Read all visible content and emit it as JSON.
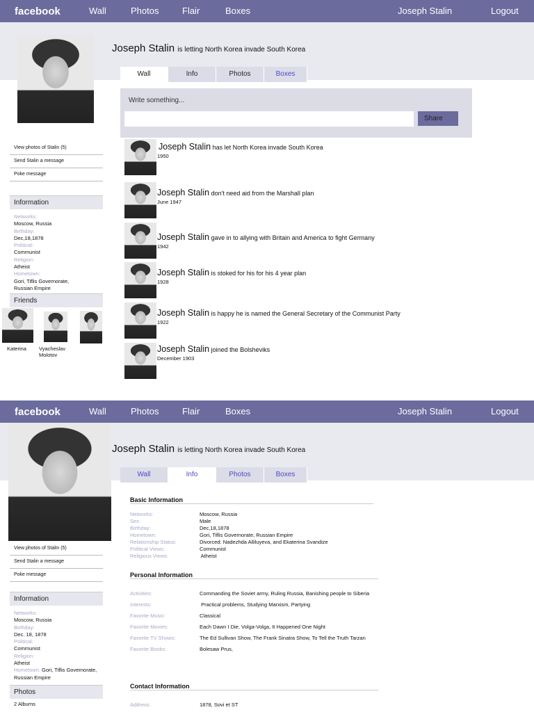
{
  "nav": {
    "logo": "facebook",
    "items": [
      "Wall",
      "Photos",
      "Flair",
      "Boxes"
    ],
    "user": "Joseph Stalin",
    "logout": "Logout"
  },
  "profile": {
    "name": "Joseph Stalin",
    "status": "is letting North Korea invade South Korea"
  },
  "tabs": [
    "Wall",
    "Info",
    "Photos",
    "Boxes"
  ],
  "sidebar1": {
    "links": [
      "View photos of Stalin  (5)",
      "Send Stalin a message",
      "Poke message"
    ],
    "information_title": "Information",
    "info": [
      [
        "Networks:",
        "Moscow, Russia"
      ],
      [
        "Birthday:",
        "Dec,18,1878"
      ],
      [
        "Political:",
        "Communist"
      ],
      [
        "Religion:",
        "Atheist"
      ],
      [
        "Hometown:",
        "Gori, Tiflis Governorate, Russian Empire"
      ]
    ],
    "friends_title": "Friends",
    "friends": [
      "Katerina",
      "Vyacheslav Molotov",
      ""
    ]
  },
  "wall": {
    "prompt": "Write something...",
    "input_value": "",
    "share": "Share",
    "posts": [
      {
        "name": "Joseph Stalin",
        "text": "has let North Korea invade South Korea",
        "date": "1950"
      },
      {
        "name": "Joseph Stalin",
        "text": "don't need aid from the Marshall plan",
        "date": "June 1947"
      },
      {
        "name": "Joseph Stalin",
        "text": "gave in to allying  with Britain and America to fight  Germany",
        "date": "1942"
      },
      {
        "name": "Joseph Stalin",
        "text": "is stoked for his for his 4 year plan",
        "date": "1928"
      },
      {
        "name": "Joseph Stalin",
        "text": " is happy he is named the General  Secretary of the Communist Party",
        "date": "1922"
      },
      {
        "name": "Joseph Stalin",
        "text": "joined the Bolsheviks",
        "date": "December 1903"
      }
    ]
  },
  "sidebar2": {
    "links": [
      "View photos of Stalin (5)",
      "Send Stalin a message",
      "Poke message"
    ],
    "information_title": "Information",
    "info": [
      [
        "Networks:",
        "Moscow, Russia"
      ],
      [
        "Birthday:",
        "Dec. 18, 1878"
      ],
      [
        "Political:",
        "Communist"
      ],
      [
        "Religion:",
        "Atheist"
      ],
      [
        "Hometown:",
        "Gori, Tiflis Governorate, Russian Empire"
      ]
    ],
    "photos_title": "Photos",
    "albums": "2 Albums"
  },
  "info_page": {
    "basic_title": "Basic Information",
    "basic": [
      [
        "Networks:",
        "Moscow, Russia"
      ],
      [
        "Sex:",
        "Male"
      ],
      [
        "Birthday:",
        "Dec,18,1878"
      ],
      [
        "Hometown:",
        "Gori, Tiflis Governorate, Russian Empire"
      ],
      [
        "Relationship Status:",
        "Divorced: Nadezhda  Alliluyeva, and Ekaterina  Svandize"
      ],
      [
        "Political Views:",
        "Communist"
      ],
      [
        "Religious Views:",
        " Atheist"
      ]
    ],
    "personal_title": "Personal Information",
    "personal": [
      [
        "Activities:",
        "Commanding the Soviet army, Ruling Russia, Banishing people to Siberia"
      ],
      [
        "Interests:",
        " Practical problems, Studying  Marxism, Partying"
      ],
      [
        "Favorite Music:",
        "Classical"
      ],
      [
        "Favorite Movies:",
        "Each Dawn I Die, Volga-Volga, It Happened  One  Night"
      ],
      [
        "Favorite TV Shows:",
        "The Ed Sullivan Show, The Frank Sinatra Show, To Tell the Truth Tarzan"
      ],
      [
        "Favorite Books:",
        "Bolesaw Prus,"
      ]
    ],
    "contact_title": "Contact Information",
    "contact": [
      [
        "Address:",
        "1878, Sovi et ST"
      ]
    ]
  }
}
